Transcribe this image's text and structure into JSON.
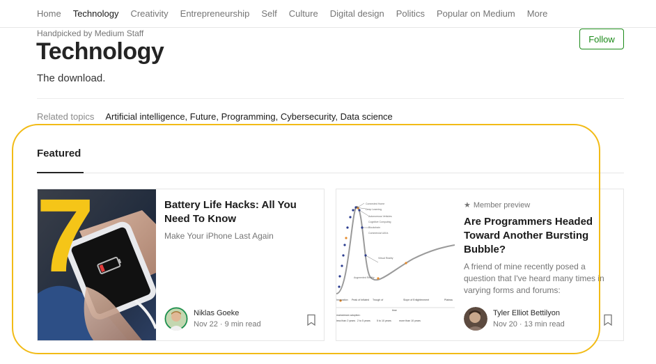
{
  "nav": {
    "items": [
      {
        "label": "Home",
        "active": false
      },
      {
        "label": "Technology",
        "active": true
      },
      {
        "label": "Creativity",
        "active": false
      },
      {
        "label": "Entrepreneurship",
        "active": false
      },
      {
        "label": "Self",
        "active": false
      },
      {
        "label": "Culture",
        "active": false
      },
      {
        "label": "Digital design",
        "active": false
      },
      {
        "label": "Politics",
        "active": false
      },
      {
        "label": "Popular on Medium",
        "active": false
      },
      {
        "label": "More",
        "active": false
      }
    ]
  },
  "header": {
    "handpicked": "Handpicked by Medium Staff",
    "title": "Technology",
    "subtitle": "The download.",
    "follow_label": "Follow"
  },
  "related": {
    "label": "Related topics",
    "topics": [
      "Artificial intelligence,",
      "Future,",
      "Programming,",
      "Cybersecurity,",
      "Data science"
    ]
  },
  "featured": {
    "label": "Featured",
    "cards": [
      {
        "title": "Battery Life Hacks: All You Need To Know",
        "subtitle": "Make Your iPhone Last Again",
        "author": "Niklas Goeke",
        "meta": "Nov 22 · 9 min read",
        "overlay_number": "7"
      },
      {
        "member_label": "Member preview",
        "title": "Are Programmers Headed Toward Another Bursting Bubble?",
        "subtitle": "A friend of mine recently posed a question that I've heard many times in varying forms and forums:",
        "author": "Tyler Elliot Bettilyon",
        "meta": "Nov 20 · 13 min read"
      }
    ]
  },
  "colors": {
    "accent_green": "#1a8917",
    "highlight": "#f2bb16"
  },
  "icons": {
    "bookmark": "bookmark-icon",
    "star": "star-icon"
  }
}
